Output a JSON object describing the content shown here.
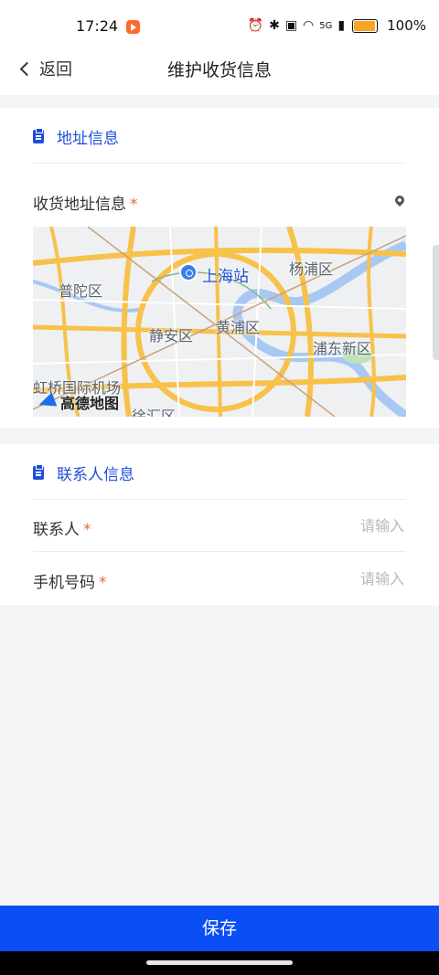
{
  "status": {
    "time": "17:24",
    "network": "5G",
    "battery": "100%",
    "battery_level": 1.0,
    "icons": [
      "alarm-icon",
      "bluetooth-icon",
      "hd-icon",
      "wifi-icon",
      "signal-icon",
      "battery-icon"
    ]
  },
  "nav": {
    "back_label": "返回",
    "title": "维护收货信息"
  },
  "address_section": {
    "title": "地址信息",
    "field_label": "收货地址信息",
    "required_mark": "*"
  },
  "map": {
    "station": "上海站",
    "districts": [
      "杨浦区",
      "普陀区",
      "静安区",
      "黄浦区",
      "浦东新区",
      "虹桥国际机场",
      "徐汇区"
    ],
    "brand": "高德地图"
  },
  "contact_section": {
    "title": "联系人信息",
    "name_label": "联系人",
    "name_placeholder": "请输入",
    "phone_label": "手机号码",
    "phone_placeholder": "请输入",
    "required_mark": "*"
  },
  "footer": {
    "save_label": "保存"
  },
  "colors": {
    "accent": "#1f4fd8",
    "button": "#0a4ff5",
    "required": "#e26d2c"
  }
}
